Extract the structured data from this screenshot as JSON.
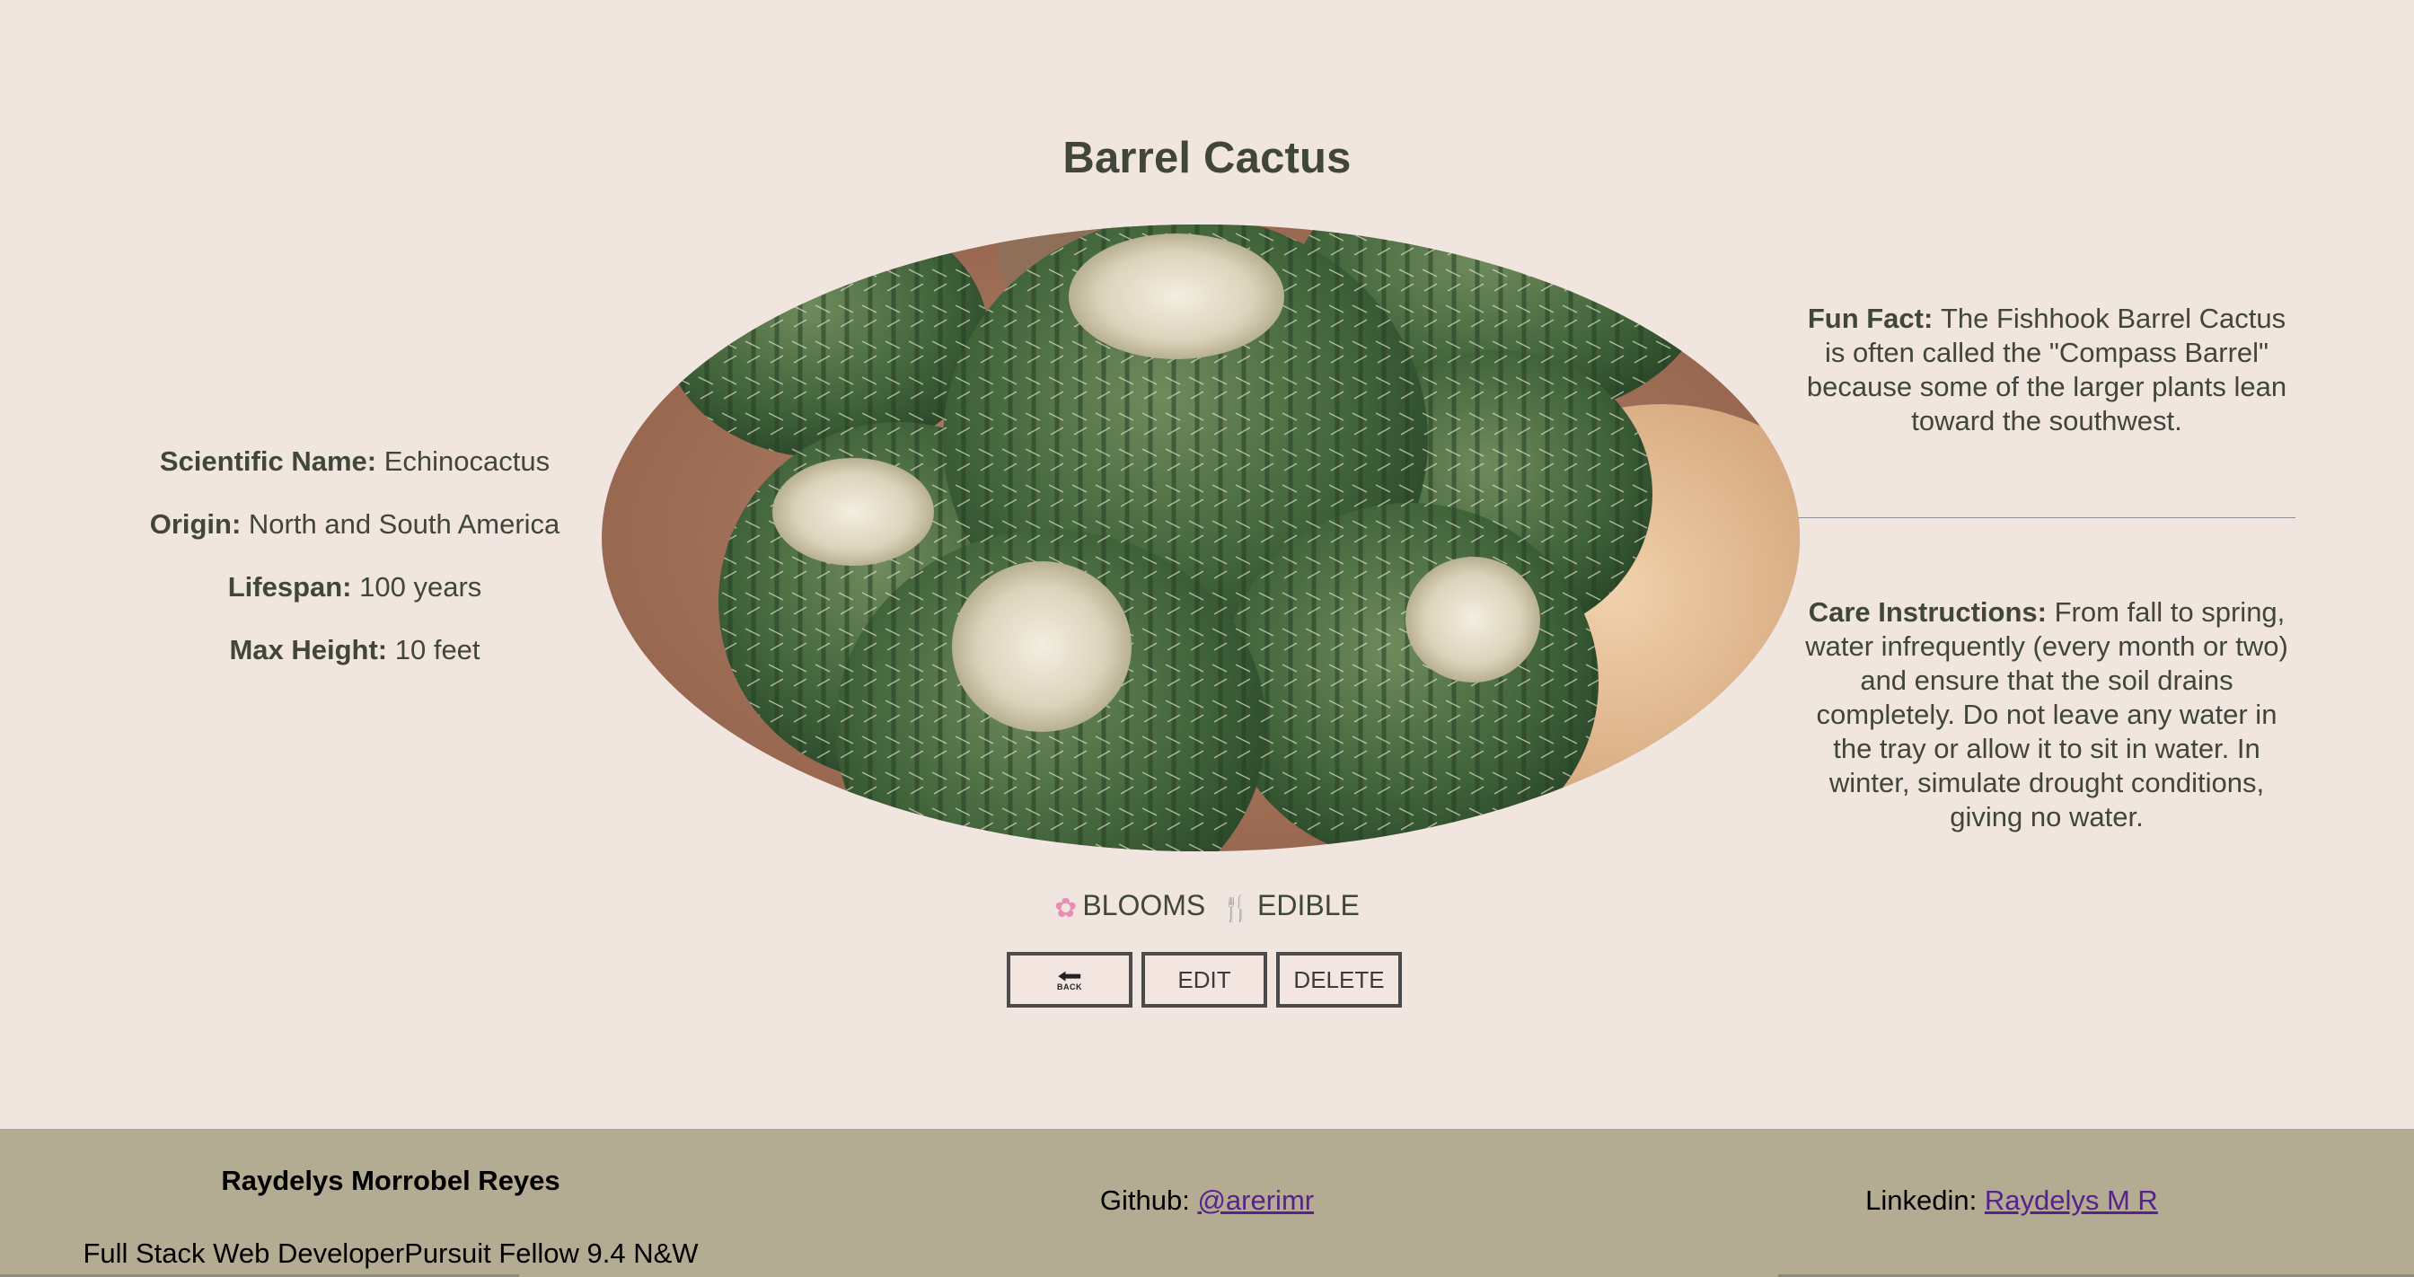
{
  "page": {
    "title": "Barrel Cactus"
  },
  "details": {
    "scientific_name": {
      "label": "Scientific Name:",
      "value": "Echinocactus"
    },
    "origin": {
      "label": "Origin:",
      "value": "North and South America"
    },
    "lifespan": {
      "label": "Lifespan:",
      "value": "100 years"
    },
    "max_height": {
      "label": "Max Height:",
      "value": "10 feet"
    }
  },
  "image": {
    "alt": "Barrel Cactus"
  },
  "fun_fact": {
    "label": "Fun Fact:",
    "text": "The Fishhook Barrel Cactus is often called the \"Compass Barrel\" because some of the larger plants lean toward the southwest."
  },
  "care": {
    "label": "Care Instructions:",
    "text": "From fall to spring, water infrequently (every month or two) and ensure that the soil drains completely. Do not leave any water in the tray or allow it to sit in water. In winter, simulate drought conditions, giving no water."
  },
  "badges": [
    {
      "icon": "blossom-icon",
      "label": "BLOOMS"
    },
    {
      "icon": "fork-and-knife-icon",
      "label": "EDIBLE"
    }
  ],
  "actions": {
    "back_icon_text": "BACK",
    "edit_label": "EDIT",
    "delete_label": "DELETE"
  },
  "footer": {
    "author": "Raydelys Morrobel Reyes",
    "role": "Full Stack Web DeveloperPursuit Fellow 9.4 N&W",
    "github_label": "Github:",
    "github_handle": "@arerimr",
    "linkedin_label": "Linkedin:",
    "linkedin_handle": "Raydelys M R"
  },
  "colors": {
    "background": "#f1e5df",
    "text": "#41463a",
    "footer_bg": "#b4ab93",
    "link": "#55238a"
  }
}
